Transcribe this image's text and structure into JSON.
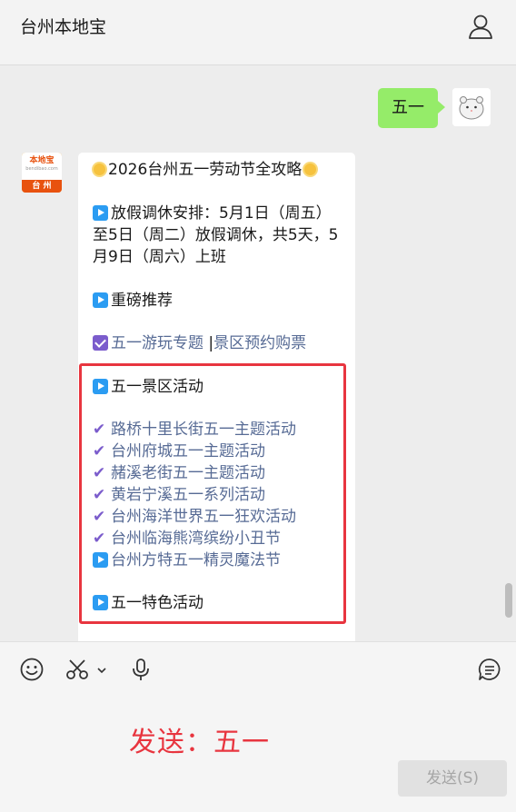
{
  "app": {
    "title": "台州本地宝"
  },
  "outgoing": {
    "text": "五一"
  },
  "avatar": {
    "logo": "本地宝",
    "url": "bendibao.com",
    "city": "台 州"
  },
  "message": {
    "title": "2026台州五一劳动节全攻略",
    "holiday_lines": [
      "放假调休安排：5月1日（周五）",
      "至5日（周二）放假调休，共5天，5",
      "月9日（周六）上班"
    ],
    "recommend": "重磅推荐",
    "links": {
      "tour": "五一游玩专题",
      "sep": " |",
      "ticket": "景区预约购票"
    },
    "scenic_heading": "五一景区活动",
    "scenic_items": [
      "路桥十里长街五一主题活动",
      "台州府城五一主题活动",
      "赭溪老街五一主题活动",
      "黄岩宁溪五一系列活动",
      "台州海洋世界五一狂欢活动",
      "台州临海熊湾缤纷小丑节"
    ],
    "last_item": "台州方特五一精灵魔法节",
    "special_heading": "五一特色活动"
  },
  "input": {
    "annotation": "发送：五一",
    "send_label": "发送(S)"
  },
  "colors": {
    "bubble_out": "#95ec69",
    "link": "#576b95",
    "highlight": "#e8353f"
  }
}
